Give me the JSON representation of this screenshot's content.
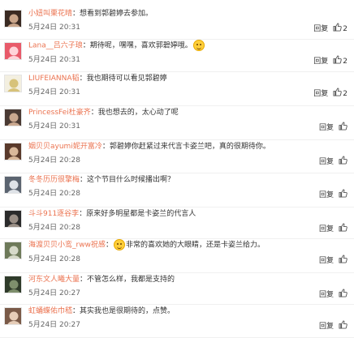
{
  "comments": [
    {
      "user": "小妞叫栗花晴",
      "text": "想看到郭碧婷去参加。",
      "emoji": false,
      "tail": "",
      "time": "5月24日 20:31",
      "reply": "回复",
      "likes": "2"
    },
    {
      "user": "Lana__吕六子琅",
      "text": "期待呢，嘿嘿，喜欢郭碧婷哦。",
      "emoji": true,
      "tail": "",
      "time": "5月24日 20:31",
      "reply": "回复",
      "likes": "2"
    },
    {
      "user": "LIUFEIANNA韬",
      "text": "我也期待可以看见郭碧婷",
      "emoji": false,
      "tail": "",
      "time": "5月24日 20:31",
      "reply": "回复",
      "likes": "2"
    },
    {
      "user": "PrincessFei杜豪齐",
      "text": "我也想去的，太心动了呢",
      "emoji": false,
      "tail": "",
      "time": "5月24日 20:31",
      "reply": "回复",
      "likes": ""
    },
    {
      "user": "姻贝贝ayumi妮开富冷",
      "text": "郭碧婷你赶紧过来代言卡姿兰吧，真的很期待你。",
      "emoji": false,
      "tail": "",
      "time": "5月24日 20:28",
      "reply": "回复",
      "likes": ""
    },
    {
      "user": "冬冬历历很擎梅",
      "text": "这个节目什么时候播出啊？",
      "emoji": false,
      "tail": "",
      "time": "5月24日 20:28",
      "reply": "回复",
      "likes": ""
    },
    {
      "user": "斗斗911逐谷李",
      "text": "原来好多明星都是卡姿兰的代言人",
      "emoji": false,
      "tail": "",
      "time": "5月24日 20:28",
      "reply": "回复",
      "likes": ""
    },
    {
      "user": "海渡贝贝小鸾_rww祝感",
      "text": "",
      "emoji": true,
      "tail": "非常的喜欢她的大眼睛，还是卡姿兰给力。",
      "time": "5月24日 20:28",
      "reply": "回复",
      "likes": ""
    },
    {
      "user": "河东文人曦大量",
      "text": "不管怎么样，我都是支持的",
      "emoji": false,
      "tail": "",
      "time": "5月24日 20:27",
      "reply": "回复",
      "likes": ""
    },
    {
      "user": "虹蛹蝶佑巾嵇",
      "text": "其实我也是很期待的，点赞。",
      "emoji": false,
      "tail": "",
      "time": "5月24日 20:27",
      "reply": "回复",
      "likes": ""
    }
  ],
  "colors": {
    "username": "#eb7350",
    "text": "#333333",
    "time": "#666666"
  },
  "icons": {
    "like": "thumbs-up-icon",
    "emoji": "grinning-face-icon"
  }
}
